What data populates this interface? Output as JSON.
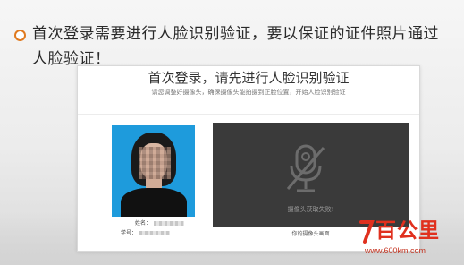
{
  "instruction": {
    "text": "首次登录需要进行人脸识别验证，要以保证的证件照片通过人脸验证！"
  },
  "card": {
    "title": "首次登录，请先进行人脸识别验证",
    "subtitle": "请您调整好摄像头，确保摄像头能拍摄到正脸位置，开始人脸识别验证",
    "name_label": "姓名：",
    "id_label": "学号："
  },
  "camera": {
    "status": "摄像头获取失败!",
    "caption": "你的摄像头画面"
  },
  "logo": {
    "text": "百公里",
    "url": "www.600km.com"
  },
  "colors": {
    "accent": "#e07a1f",
    "logo": "#e0301e",
    "photo_background": "#1e9bdc",
    "camera_background": "#3a3a3a"
  }
}
